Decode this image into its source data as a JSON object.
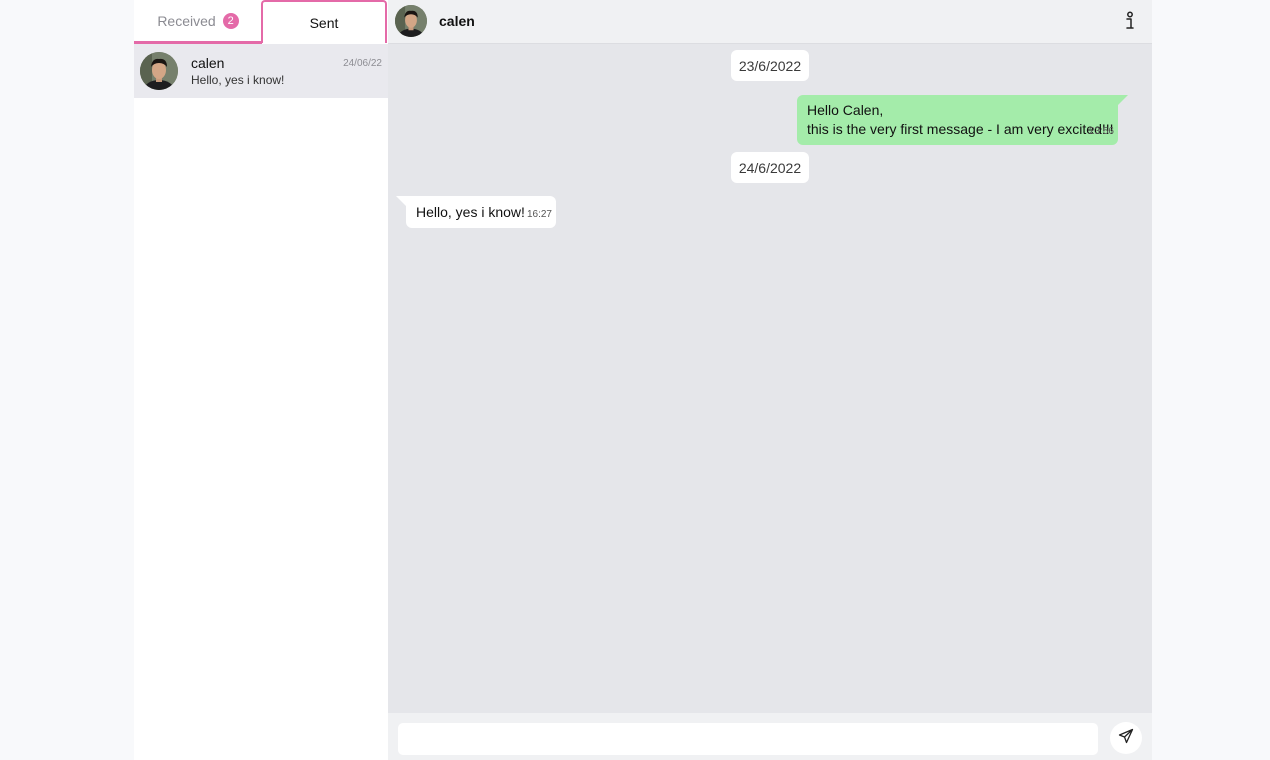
{
  "tabs": {
    "received_label": "Received",
    "received_count": "2",
    "sent_label": "Sent"
  },
  "conversations": [
    {
      "name": "calen",
      "date": "24/06/22",
      "preview": "Hello, yes i know!"
    }
  ],
  "chat": {
    "contact_name": "calen",
    "messages": [
      {
        "type": "date",
        "text": "23/6/2022"
      },
      {
        "type": "sent",
        "lines": [
          "Hello Calen,",
          "this is the very first message - I am very excited!!!"
        ],
        "time": "23:56"
      },
      {
        "type": "date",
        "text": "24/6/2022"
      },
      {
        "type": "received",
        "lines": [
          "Hello, yes i know!"
        ],
        "time": "16:27"
      }
    ]
  },
  "composer": {
    "placeholder": "",
    "value": ""
  },
  "icons": {
    "header_action": "info-icon",
    "send": "send-icon"
  },
  "colors": {
    "accent": "#e46aa8",
    "sent_bubble": "#a4ecaa",
    "received_bubble": "#ffffff",
    "chat_background": "#e5e6ea"
  }
}
